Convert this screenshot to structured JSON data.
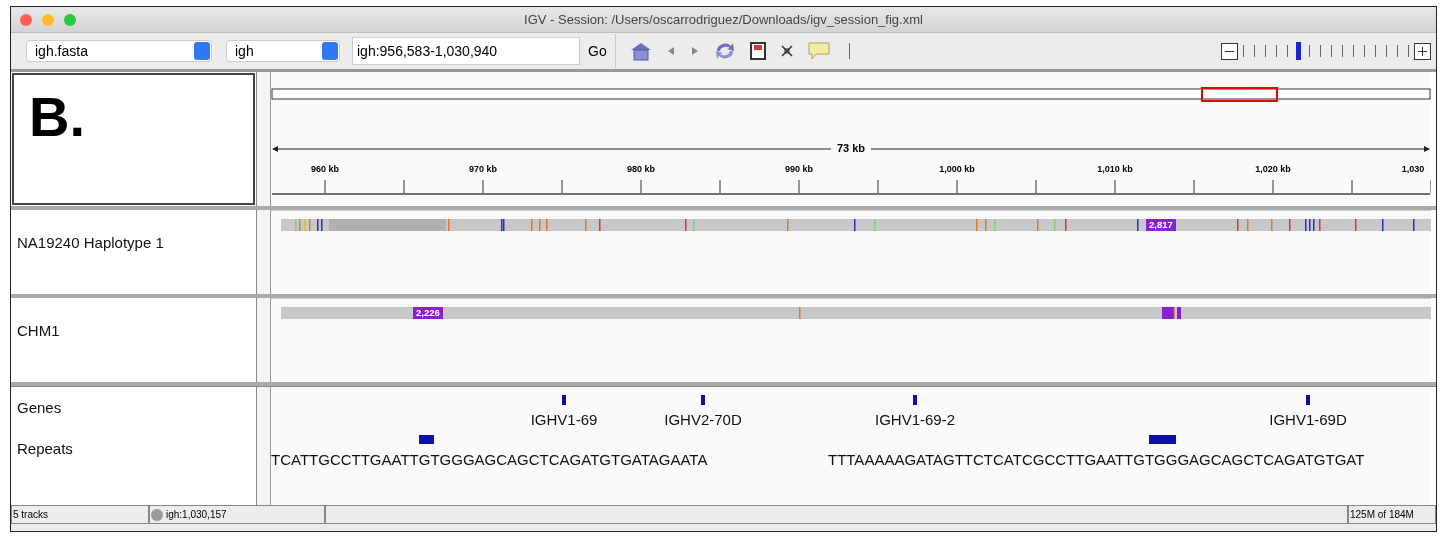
{
  "window": {
    "title": "IGV - Session: /Users/oscarrodriguez/Downloads/igv_session_fig.xml"
  },
  "toolbar": {
    "genome": "igh.fasta",
    "chromosome": "igh",
    "locus": "igh:956,583-1,030,940",
    "go": "Go",
    "zoom": {
      "level": 0.33
    }
  },
  "header": {
    "label": "B.",
    "span": "73 kb",
    "ruler_ticks": [
      "960 kb",
      "970 kb",
      "980 kb",
      "990 kb",
      "1,000 kb",
      "1,010 kb",
      "1,020 kb",
      "1,030"
    ]
  },
  "tracks": [
    {
      "name": "NA19240 Haplotype 1",
      "count": "2,817"
    },
    {
      "name": "CHM1",
      "count": "2,226"
    }
  ],
  "annotation_tracks": [
    {
      "name": "Genes",
      "kind": "genes",
      "features": [
        "IGHV1-69",
        "IGHV2-70D",
        "IGHV1-69-2",
        "IGHV1-69D"
      ]
    },
    {
      "name": "Repeats",
      "kind": "sequence",
      "sequences": [
        "TCATTGCCTTGAATTGTGGGAGCAGCTCAGATGTGATAGAATA",
        "TTTAAAAAGATAGTTCTCATCGCCTTGAATTGTGGGAGCAGCTCAGATGTGAT"
      ]
    }
  ],
  "status_bar": {
    "tracks": "5 tracks",
    "position": "igh:1,030,157",
    "memory": "125M of 184M"
  }
}
